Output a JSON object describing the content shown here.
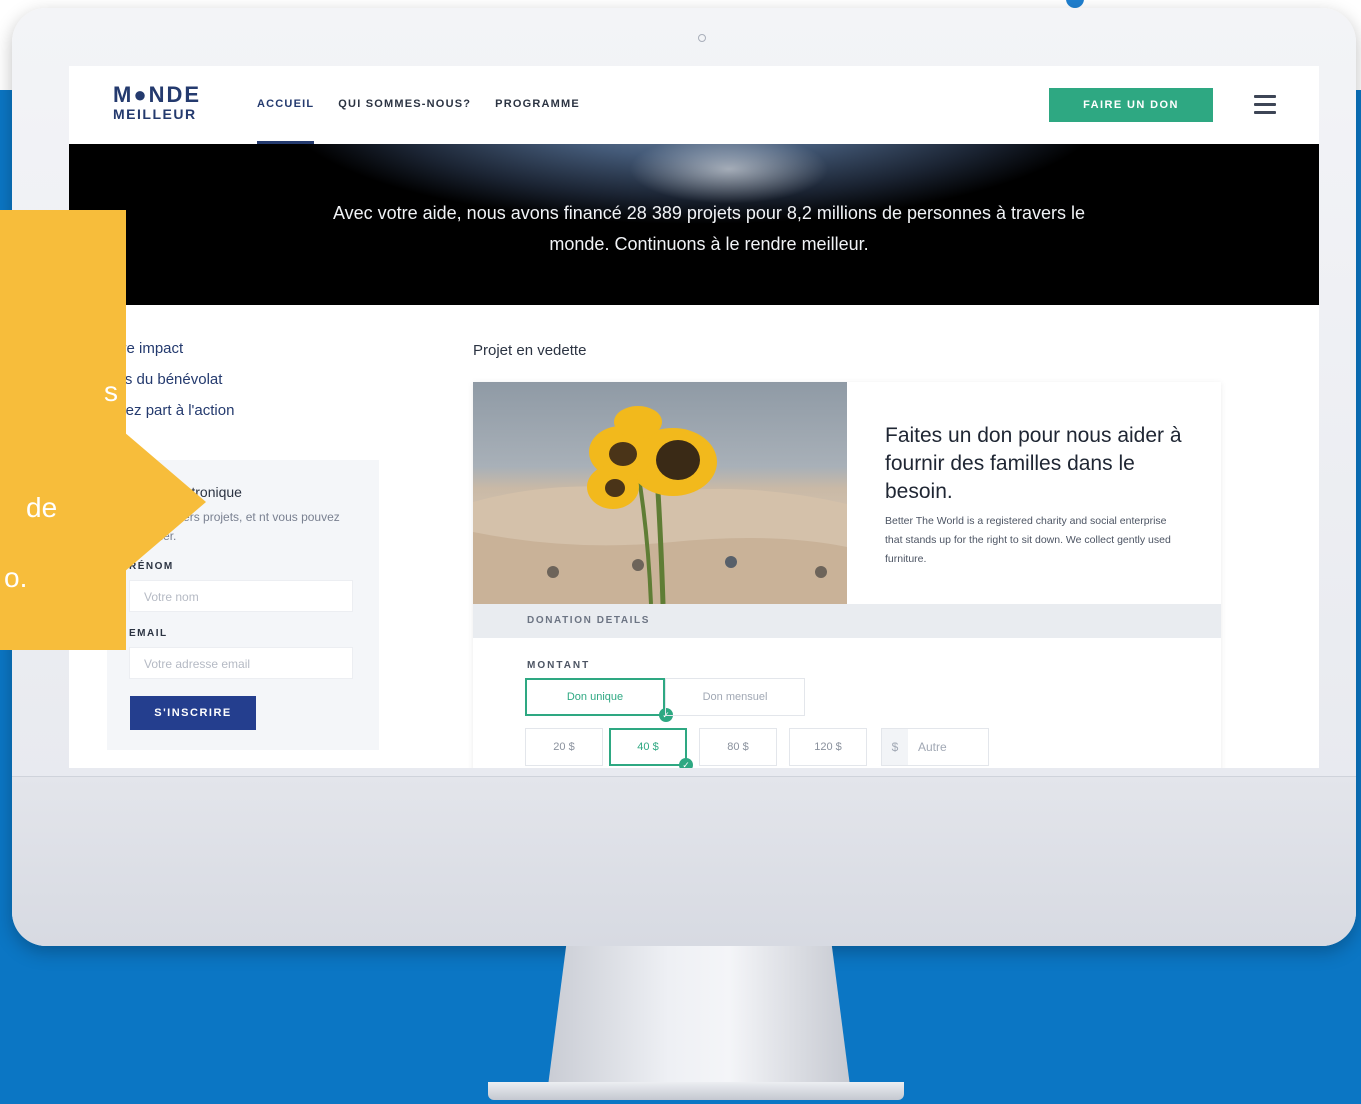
{
  "brand": {
    "logo_top": "M●NDE",
    "logo_bottom": "MEILLEUR"
  },
  "nav": {
    "links": [
      {
        "label": "ACCUEIL",
        "active": true
      },
      {
        "label": "QUI SOMMES-NOUS?",
        "active": false
      },
      {
        "label": "PROGRAMME",
        "active": false
      }
    ],
    "donate_label": "FAIRE UN DON",
    "menu_icon": "hamburger-menu-icon"
  },
  "hero": {
    "text": "Avec votre aide, nous avons financé 28 389 projets pour 8,2 millions de personnes à travers le monde. Continuons à le rendre meilleur."
  },
  "sidebar": {
    "links": [
      "otre impact",
      "ites du bénévolat",
      "enez part à l'action"
    ],
    "newsletter": {
      "title": "tin électronique",
      "desc": "s derniers projets, et nt vous pouvez aider.",
      "name_label": "RÉNOM",
      "name_placeholder": "Votre nom",
      "email_label": "EMAIL",
      "email_placeholder": "Votre adresse email",
      "submit_label": "S'INSCRIRE"
    }
  },
  "featured": {
    "label": "Projet en vedette",
    "title": "Faites un don pour nous aider à fournir des familles dans le besoin.",
    "body": "Better The World is a registered charity and social enterprise that stands up for the right to sit down. We collect gently used furniture.",
    "details_label": "DONATION DETAILS",
    "amount_label": "MONTANT",
    "frequency": [
      {
        "label": "Don unique",
        "selected": true
      },
      {
        "label": "Don mensuel",
        "selected": false
      }
    ],
    "amounts": [
      {
        "label": "20 $",
        "selected": false
      },
      {
        "label": "40 $",
        "selected": true
      },
      {
        "label": "80 $",
        "selected": false
      },
      {
        "label": "120 $",
        "selected": false
      }
    ],
    "other_currency": "$",
    "other_placeholder": "Autre"
  },
  "callout": {
    "fragments": [
      "s",
      "de",
      "o."
    ]
  },
  "colors": {
    "background_blue": "#0b76c4",
    "brand_navy": "#243a6e",
    "accent_green": "#2ea882",
    "callout_yellow": "#f7bd3b"
  }
}
